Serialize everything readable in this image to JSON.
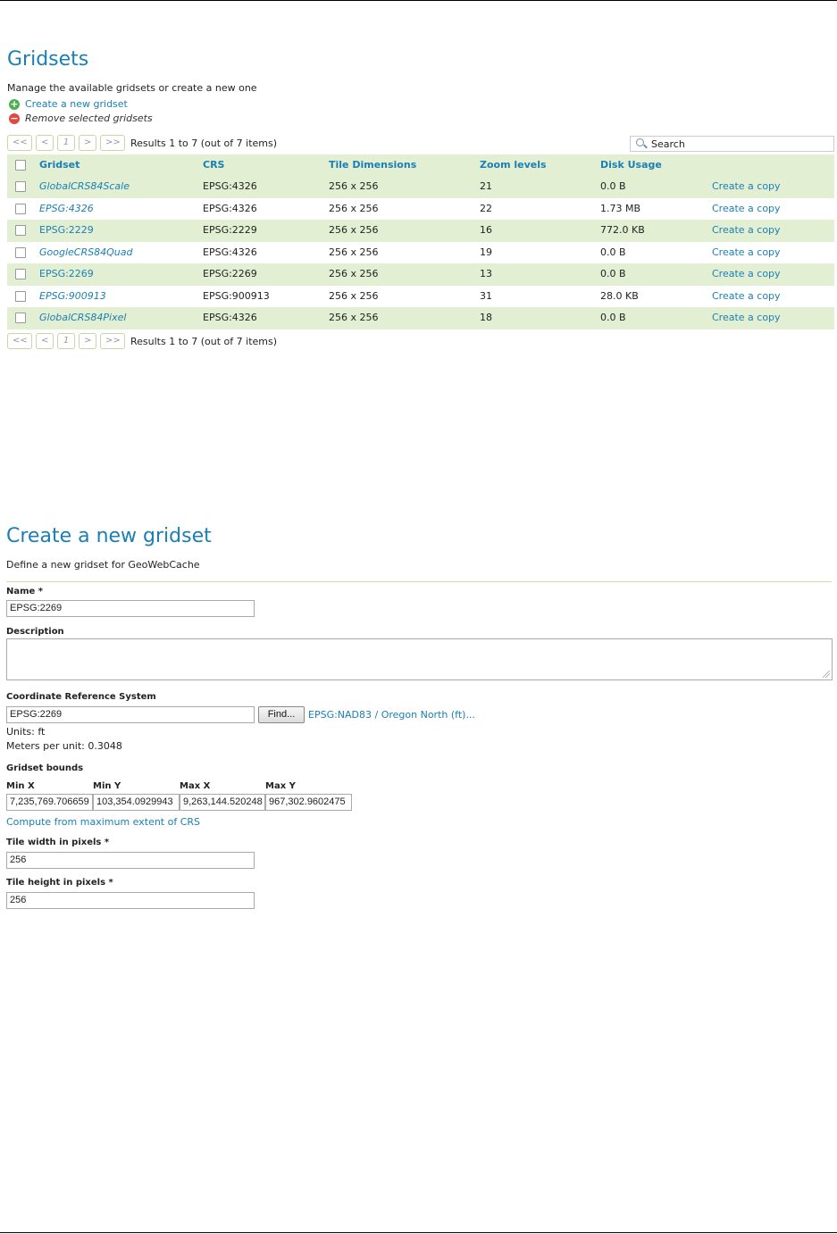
{
  "gridsets": {
    "title": "Gridsets",
    "description": "Manage the available gridsets or create a new one",
    "create_link": "Create a new gridset",
    "remove_link": "Remove selected gridsets",
    "pager": {
      "first": "<<",
      "prev": "<",
      "page": "1",
      "next": ">",
      "last": ">>",
      "results": "Results 1 to 7 (out of 7 items)"
    },
    "search_placeholder": "Search",
    "columns": {
      "gridset": "Gridset",
      "crs": "CRS",
      "tile_dimensions": "Tile Dimensions",
      "zoom_levels": "Zoom levels",
      "disk_usage": "Disk Usage"
    },
    "rows": [
      {
        "name": "GlobalCRS84Scale",
        "crs": "EPSG:4326",
        "tile": "256 x 256",
        "zoom": "21",
        "disk": "0.0 B",
        "action": "Create a copy"
      },
      {
        "name": "EPSG:4326",
        "crs": "EPSG:4326",
        "tile": "256 x 256",
        "zoom": "22",
        "disk": "1.73 MB",
        "action": "Create a copy"
      },
      {
        "name": "EPSG:2229",
        "crs": "EPSG:2229",
        "tile": "256 x 256",
        "zoom": "16",
        "disk": "772.0 KB",
        "action": "Create a copy"
      },
      {
        "name": "GoogleCRS84Quad",
        "crs": "EPSG:4326",
        "tile": "256 x 256",
        "zoom": "19",
        "disk": "0.0 B",
        "action": "Create a copy"
      },
      {
        "name": "EPSG:2269",
        "crs": "EPSG:2269",
        "tile": "256 x 256",
        "zoom": "13",
        "disk": "0.0 B",
        "action": "Create a copy"
      },
      {
        "name": "EPSG:900913",
        "crs": "EPSG:900913",
        "tile": "256 x 256",
        "zoom": "31",
        "disk": "28.0 KB",
        "action": "Create a copy"
      },
      {
        "name": "GlobalCRS84Pixel",
        "crs": "EPSG:4326",
        "tile": "256 x 256",
        "zoom": "18",
        "disk": "0.0 B",
        "action": "Create a copy"
      }
    ]
  },
  "create": {
    "title": "Create a new gridset",
    "description": "Define a new gridset for GeoWebCache",
    "name_label": "Name *",
    "name_value": "EPSG:2269",
    "description_label": "Description",
    "crs_label": "Coordinate Reference System",
    "crs_value": "EPSG:2269",
    "find_button": "Find...",
    "crs_link": "EPSG:NAD83 / Oregon North (ft)...",
    "units": "Units: ft",
    "meters_per_unit": "Meters per unit: 0.3048",
    "bounds_label": "Gridset bounds",
    "bounds": {
      "min_x_label": "Min X",
      "min_y_label": "Min Y",
      "max_x_label": "Max X",
      "max_y_label": "Max Y",
      "min_x": "7,235,769.706659",
      "min_y": "103,354.0929943",
      "max_x": "9,263,144.520248",
      "max_y": "967,302.9602475"
    },
    "compute_link": "Compute from maximum extent of CRS",
    "tile_width_label": "Tile width in pixels *",
    "tile_width_value": "256",
    "tile_height_label": "Tile height in pixels *",
    "tile_height_value": "256"
  }
}
